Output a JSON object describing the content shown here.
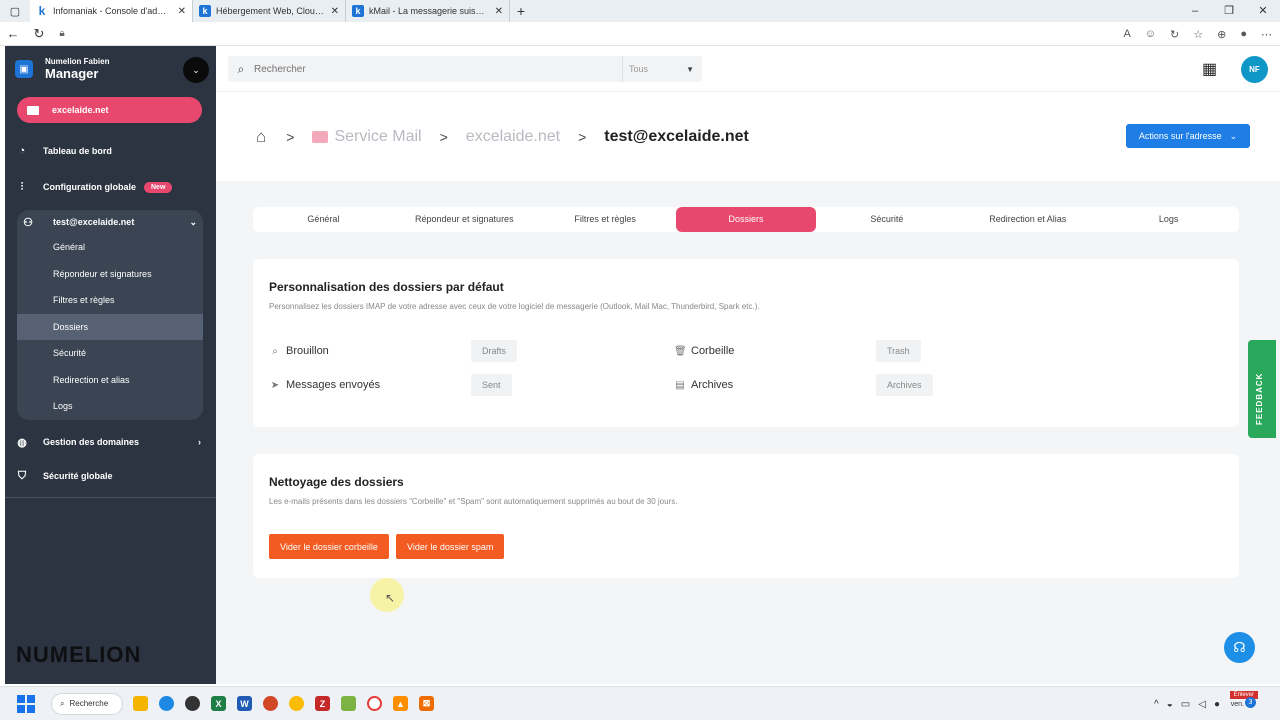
{
  "browser": {
    "tabs": [
      {
        "title": "Infomaniak - Console d'administ",
        "active": true
      },
      {
        "title": "Hébergement Web, Cloud C",
        "active": false
      },
      {
        "title": "kMail - La messagerie suisse séc",
        "active": false
      }
    ]
  },
  "sidebar": {
    "account_owner": "Numelion Fabien",
    "account_app": "Manager",
    "domain": "excelaide.net",
    "items": [
      {
        "label": "Tableau de bord",
        "icon": "dashboard-icon"
      },
      {
        "label": "Configuration globale",
        "icon": "sliders-icon",
        "badge": "New"
      }
    ],
    "mailbox": {
      "label": "test@excelaide.net",
      "subitems": [
        "Général",
        "Répondeur et signatures",
        "Filtres et règles",
        "Dossiers",
        "Sécurité",
        "Redirection et alias",
        "Logs"
      ],
      "active": "Dossiers"
    },
    "bottom_items": [
      {
        "label": "Gestion des domaines",
        "icon": "globe-icon"
      },
      {
        "label": "Sécurité globale",
        "icon": "shield-icon"
      }
    ],
    "brand": "NUMELION"
  },
  "topbar": {
    "search_placeholder": "Rechercher",
    "search_scope": "Tous",
    "avatar_initials": "NF"
  },
  "breadcrumb": {
    "service": "Service Mail",
    "domain": "excelaide.net",
    "current": "test@excelaide.net",
    "actions_label": "Actions sur l'adresse"
  },
  "tabs": [
    "Général",
    "Répondeur et signatures",
    "Filtres et règles",
    "Dossiers",
    "Sécurité",
    "Redirection et Alias",
    "Logs"
  ],
  "active_tab": "Dossiers",
  "folders_card": {
    "title": "Personnalisation des dossiers par défaut",
    "description": "Personnalisez les dossiers IMAP de votre adresse avec ceux de votre logiciel de messagerie (Outlook, Mail Mac, Thunderbird, Spark etc.).",
    "rows": [
      {
        "label": "Brouillon",
        "value": "Drafts",
        "icon": "draft-icon"
      },
      {
        "label": "Corbeille",
        "value": "Trash",
        "icon": "trash-icon"
      },
      {
        "label": "Messages envoyés",
        "value": "Sent",
        "icon": "send-icon"
      },
      {
        "label": "Archives",
        "value": "Archives",
        "icon": "archive-icon"
      }
    ]
  },
  "cleanup_card": {
    "title": "Nettoyage des dossiers",
    "description": "Les e-mails présents dans les dossiers \"Corbeille\" et \"Spam\" sont automatiquement supprimés au bout de 30 jours.",
    "button_trash": "Vider le dossier corbeille",
    "button_spam": "Vider le dossier spam"
  },
  "feedback_label": "FEEDBACK",
  "taskbar": {
    "search_label": "Recherche",
    "clock_day": "ven.",
    "notif_label": "Enlever",
    "notif_count": "3"
  },
  "colors": {
    "accent_pink": "#e8476e",
    "primary_blue": "#1e7ee6",
    "orange_button": "#f25b21",
    "feedback_green": "#2aa85c",
    "sidebar_bg": "#2b3440"
  }
}
